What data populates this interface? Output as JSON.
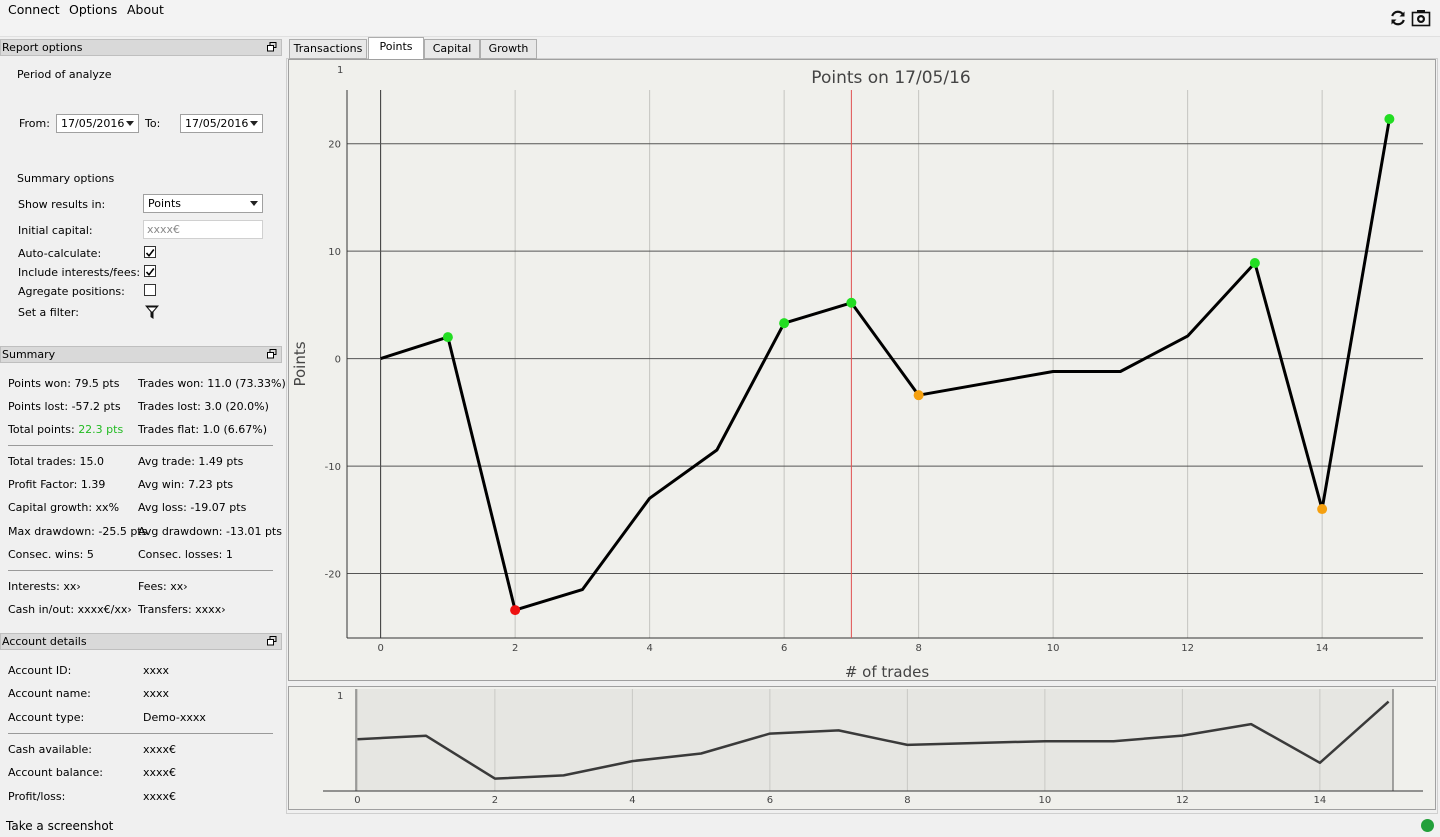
{
  "menu": {
    "connect": "Connect",
    "options": "Options",
    "about": "About"
  },
  "toolbar": {
    "refresh_icon": "refresh-icon",
    "camera_icon": "camera-icon"
  },
  "report_options": {
    "header": "Report options",
    "period_label": "Period of analyze",
    "from_label": "From:",
    "from_value": "17/05/2016",
    "to_label": "To:",
    "to_value": "17/05/2016",
    "summary_options_label": "Summary options",
    "show_results_label": "Show results in:",
    "show_results_value": "Points",
    "initial_capital_label": "Initial capital:",
    "initial_capital_placeholder": "xxxx€",
    "auto_calc_label": "Auto-calculate:",
    "auto_calc_checked": true,
    "include_interests_label": "Include interests/fees:",
    "include_interests_checked": true,
    "aggregate_label": "Agregate positions:",
    "aggregate_checked": false,
    "filter_label": "Set a filter:"
  },
  "summary": {
    "header": "Summary",
    "points_won": "Points won: 79.5 pts",
    "trades_won": "Trades won: 11.0 (73.33%)",
    "points_lost": "Points lost: -57.2 pts",
    "trades_lost": "Trades lost: 3.0 (20.0%)",
    "total_points_label": "Total points:",
    "total_points_value": "22.3 pts",
    "total_points_color": "#22bb22",
    "trades_flat": "Trades flat: 1.0 (6.67%)",
    "total_trades": "Total trades: 15.0",
    "avg_trade": "Avg trade: 1.49 pts",
    "profit_factor": "Profit Factor: 1.39",
    "avg_win": "Avg win: 7.23 pts",
    "capital_growth": "Capital growth: xx%",
    "avg_loss": "Avg loss: -19.07 pts",
    "max_drawdown": "Max drawdown: -25.5 pts",
    "avg_drawdown": "Avg drawdown: -13.01 pts",
    "consec_wins": "Consec. wins: 5",
    "consec_losses": "Consec. losses: 1",
    "interests": "Interests: xx›",
    "fees": "Fees: xx›",
    "cash_inout": "Cash in/out: xxxx€/xx›",
    "transfers": "Transfers: xxxx›"
  },
  "account": {
    "header": "Account details",
    "id_label": "Account ID:",
    "id_value": "xxxx",
    "name_label": "Account name:",
    "name_value": "xxxx",
    "type_label": "Account type:",
    "type_value": "Demo-xxxx",
    "cash_label": "Cash available:",
    "cash_value": "xxxx€",
    "balance_label": "Account balance:",
    "balance_value": "xxxx€",
    "pl_label": "Profit/loss:",
    "pl_value": "xxxx€"
  },
  "tabs": [
    "Transactions",
    "Points",
    "Capital",
    "Growth"
  ],
  "active_tab": "Points",
  "status": {
    "text": "Take a screenshot",
    "indicator_color": "#22a03a"
  },
  "chart_data": {
    "type": "line",
    "title": "Points on 17/05/16",
    "xlabel": "# of trades",
    "ylabel": "Points",
    "xlim": [
      -0.5,
      15.5
    ],
    "ylim": [
      -26,
      25
    ],
    "xticks": [
      0,
      2,
      4,
      6,
      8,
      10,
      12,
      14
    ],
    "yticks": [
      -20,
      -10,
      0,
      10,
      20
    ],
    "corner_label": "1",
    "grid": true,
    "marker_line_x": 7,
    "line_color": "#000000",
    "series": [
      {
        "x": [
          0,
          1,
          2,
          3,
          4,
          5,
          6,
          7,
          8,
          9,
          10,
          11,
          12,
          13,
          14,
          15
        ],
        "values": [
          0,
          2,
          -23.4,
          -21.5,
          -13,
          -8.5,
          3.3,
          5.2,
          -3.4,
          -2.3,
          -1.2,
          -1.2,
          2.1,
          8.9,
          -14,
          22.3
        ]
      }
    ],
    "markers": [
      {
        "x": 1,
        "y": 2,
        "color": "#22dd22"
      },
      {
        "x": 2,
        "y": -23.4,
        "color": "#ee1111"
      },
      {
        "x": 6,
        "y": 3.3,
        "color": "#22dd22"
      },
      {
        "x": 7,
        "y": 5.2,
        "color": "#22dd22"
      },
      {
        "x": 8,
        "y": -3.4,
        "color": "#f5a00f"
      },
      {
        "x": 13,
        "y": 8.9,
        "color": "#22dd22"
      },
      {
        "x": 14,
        "y": -14,
        "color": "#f5a00f"
      },
      {
        "x": 15,
        "y": 22.3,
        "color": "#22dd22"
      }
    ],
    "navigator": {
      "corner_label": "1",
      "xticks": [
        0,
        2,
        4,
        6,
        8,
        10,
        12,
        14
      ],
      "line_color": "#3a3a3a"
    }
  }
}
